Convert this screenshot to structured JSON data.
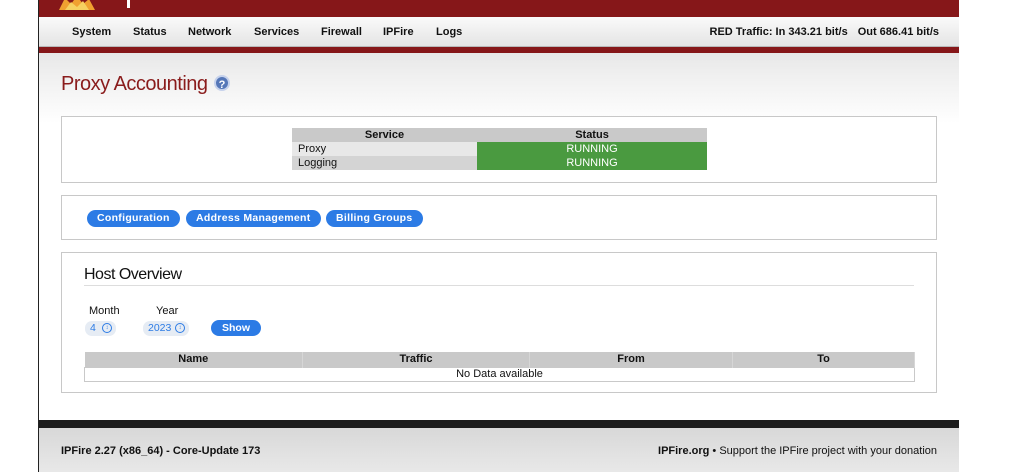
{
  "nav": {
    "items": [
      "System",
      "Status",
      "Network",
      "Services",
      "Firewall",
      "IPFire",
      "Logs"
    ],
    "traffic_in": "RED Traffic: In 343.21 bit/s",
    "traffic_out": "Out 686.41 bit/s"
  },
  "page": {
    "title": "Proxy Accounting",
    "help_icon": "?"
  },
  "services": {
    "headers": [
      "Service",
      "Status"
    ],
    "rows": [
      {
        "name": "Proxy",
        "status": "RUNNING"
      },
      {
        "name": "Logging",
        "status": "RUNNING"
      }
    ],
    "running_color": "#4a9a40"
  },
  "actions": [
    "Configuration",
    "Address Management",
    "Billing Groups"
  ],
  "host": {
    "title": "Host Overview",
    "month_label": "Month",
    "year_label": "Year",
    "month_value": "4",
    "year_value": "2023",
    "show_label": "Show",
    "columns": [
      "Name",
      "Traffic",
      "From",
      "To"
    ],
    "empty_text": "No Data available"
  },
  "footer": {
    "left": "IPFire 2.27 (x86_64) - Core-Update 173",
    "right_link": "IPFire.org",
    "right_text": " • Support the IPFire project with your donation"
  },
  "colors": {
    "brand": "#861719",
    "accent": "#2c7be5"
  }
}
